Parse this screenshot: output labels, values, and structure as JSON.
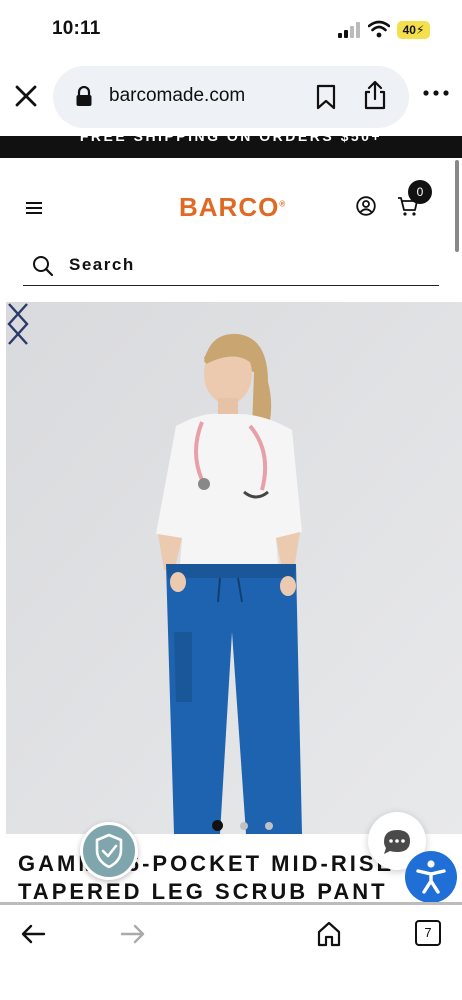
{
  "status_bar": {
    "time": "10:11",
    "battery_label": "40"
  },
  "browser": {
    "url": "barcomade.com",
    "tab_count": "7"
  },
  "promo": {
    "text": "FREE SHIPPING ON ORDERS $50+"
  },
  "header": {
    "logo": "BARCO",
    "cart_count": "0",
    "brand_color": "#e06a25"
  },
  "search": {
    "label": "Search"
  },
  "product": {
    "title_line1": "GAMMA 6-POCKET MID-RISE",
    "title_line2": "TAPERED LEG SCRUB PANT",
    "carousel": {
      "slide_count": 3,
      "active_slide": 1
    },
    "pant_color": "#1e63b0"
  },
  "widgets": {
    "accessibility_color": "#1f6fd6"
  }
}
